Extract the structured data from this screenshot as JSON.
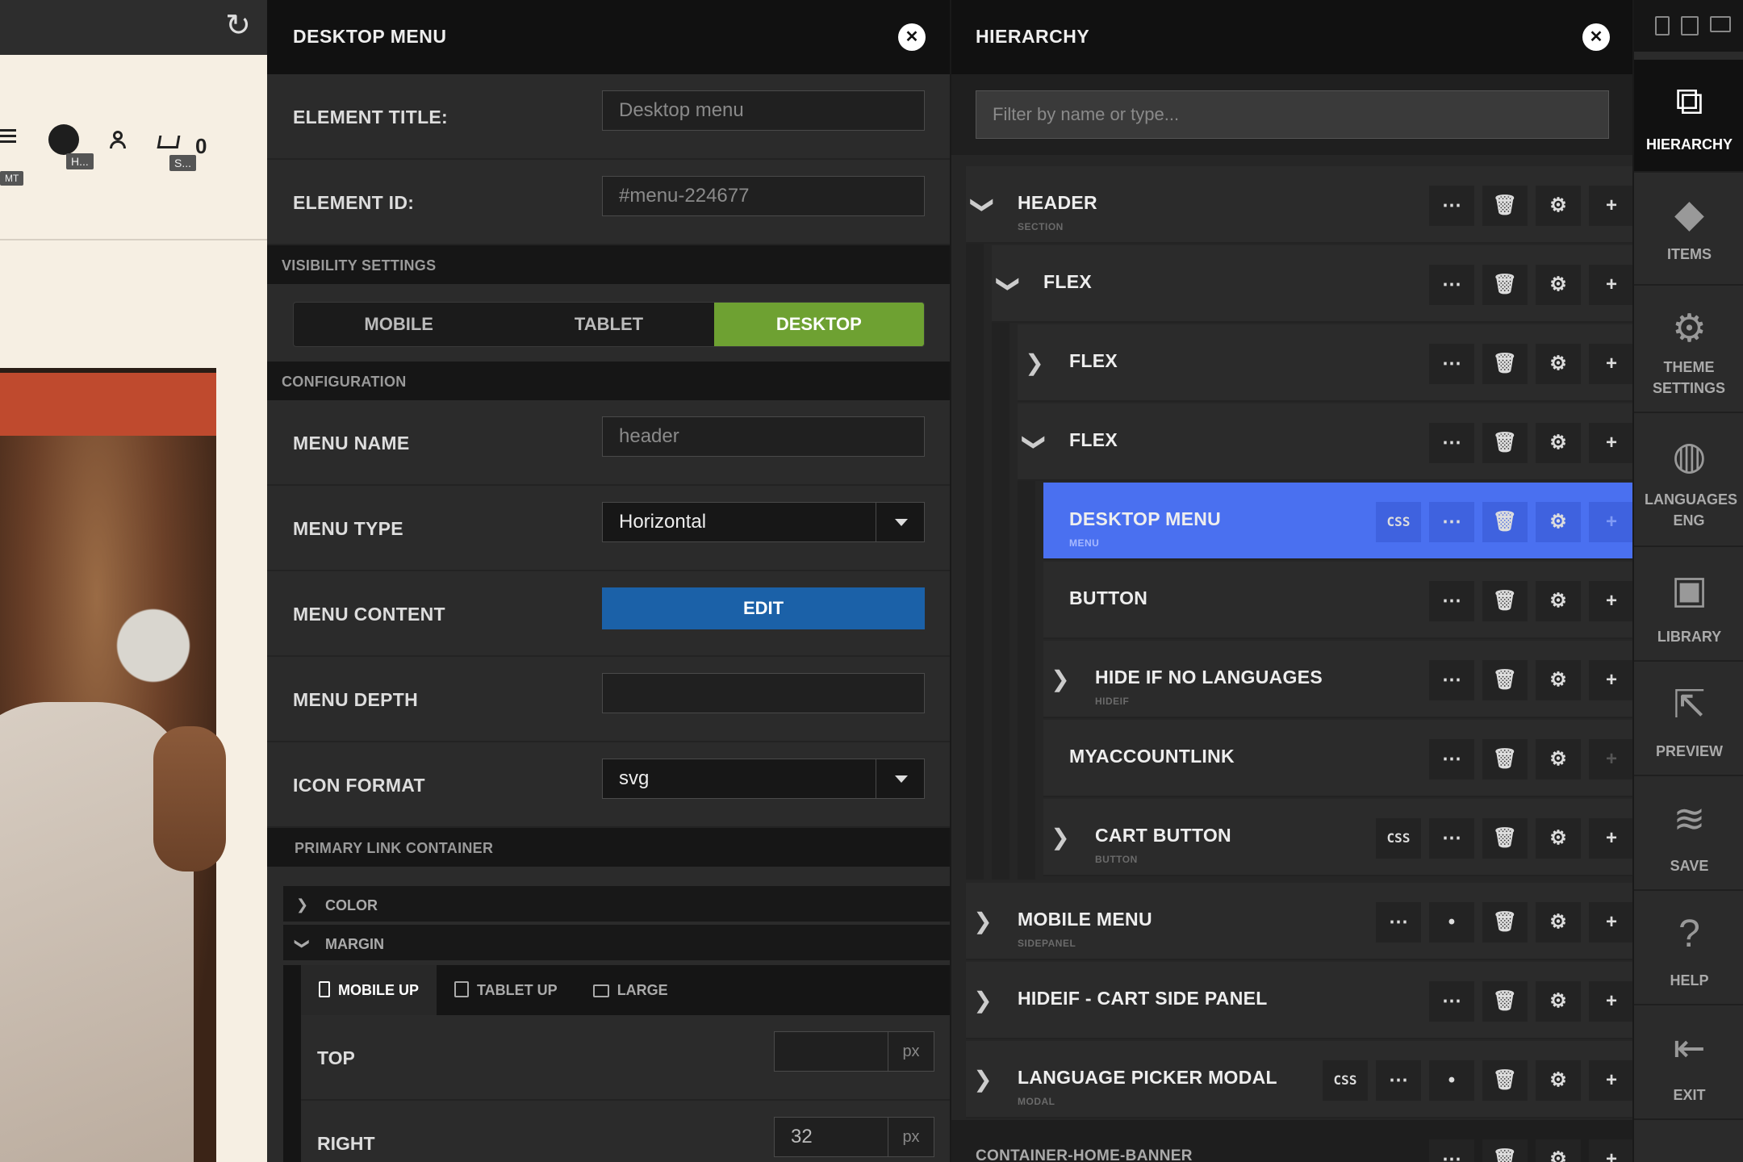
{
  "preview": {
    "cart_count": "0",
    "tags": {
      "lang": "H...",
      "cart": "S...",
      "mt": "MT"
    }
  },
  "settings": {
    "title": "DESKTOP MENU",
    "element_title_label": "ELEMENT TITLE:",
    "element_title_value": "Desktop menu",
    "element_id_label": "ELEMENT ID:",
    "element_id_value": "#menu-224677",
    "visibility_label": "VISIBILITY SETTINGS",
    "visibility_options": [
      "MOBILE",
      "TABLET",
      "DESKTOP"
    ],
    "visibility_active": "DESKTOP",
    "configuration_label": "CONFIGURATION",
    "menu_name_label": "MENU NAME",
    "menu_name_value": "header",
    "menu_type_label": "MENU TYPE",
    "menu_type_value": "Horizontal",
    "menu_content_label": "MENU CONTENT",
    "edit_label": "EDIT",
    "menu_depth_label": "MENU DEPTH",
    "menu_depth_value": "",
    "icon_format_label": "ICON FORMAT",
    "icon_format_value": "svg",
    "primary_link_label": "PRIMARY LINK CONTAINER",
    "color_label": "COLOR",
    "margin_label": "MARGIN",
    "breakpoints": [
      "MOBILE UP",
      "TABLET UP",
      "LARGE"
    ],
    "top_label": "TOP",
    "top_value": "",
    "right_label": "RIGHT",
    "right_value": "32",
    "unit": "px"
  },
  "hierarchy": {
    "title": "HIERARCHY",
    "filter_placeholder": "Filter by name or type...",
    "rows": [
      {
        "name": "HEADER",
        "type": "SECTION"
      },
      {
        "name": "FLEX",
        "type": ""
      },
      {
        "name": "FLEX",
        "type": ""
      },
      {
        "name": "FLEX",
        "type": ""
      },
      {
        "name": "DESKTOP MENU",
        "type": "MENU"
      },
      {
        "name": "BUTTON",
        "type": ""
      },
      {
        "name": "HIDE IF NO LANGUAGES",
        "type": "HIDEIF"
      },
      {
        "name": "MYACCOUNTLINK",
        "type": ""
      },
      {
        "name": "CART BUTTON",
        "type": "BUTTON"
      },
      {
        "name": "MOBILE MENU",
        "type": "SIDEPANEL"
      },
      {
        "name": "HIDEIF - CART SIDE PANEL",
        "type": ""
      },
      {
        "name": "LANGUAGE PICKER MODAL",
        "type": "MODAL"
      },
      {
        "name": "CONTAINER-HOME-BANNER",
        "type": ""
      }
    ],
    "css_label": "CSS"
  },
  "toolbar": {
    "items": [
      {
        "label": "HIERARCHY",
        "icon": "hierarchy-icon"
      },
      {
        "label": "ITEMS",
        "icon": "tags-icon"
      },
      {
        "label": "THEME SETTINGS",
        "icon": "gear-icon"
      },
      {
        "label": "LANGUAGES ENG",
        "icon": "globe-icon"
      },
      {
        "label": "LIBRARY",
        "icon": "briefcase-icon"
      },
      {
        "label": "PREVIEW",
        "icon": "external-link-icon"
      },
      {
        "label": "SAVE",
        "icon": "database-icon"
      },
      {
        "label": "HELP",
        "icon": "question-icon"
      },
      {
        "label": "EXIT",
        "icon": "exit-icon"
      }
    ]
  },
  "colors": {
    "accent_green": "#6ea132",
    "edit_blue": "#1b61a8",
    "selected_blue": "#4a70f0",
    "preview_red": "#bf4a2e"
  }
}
